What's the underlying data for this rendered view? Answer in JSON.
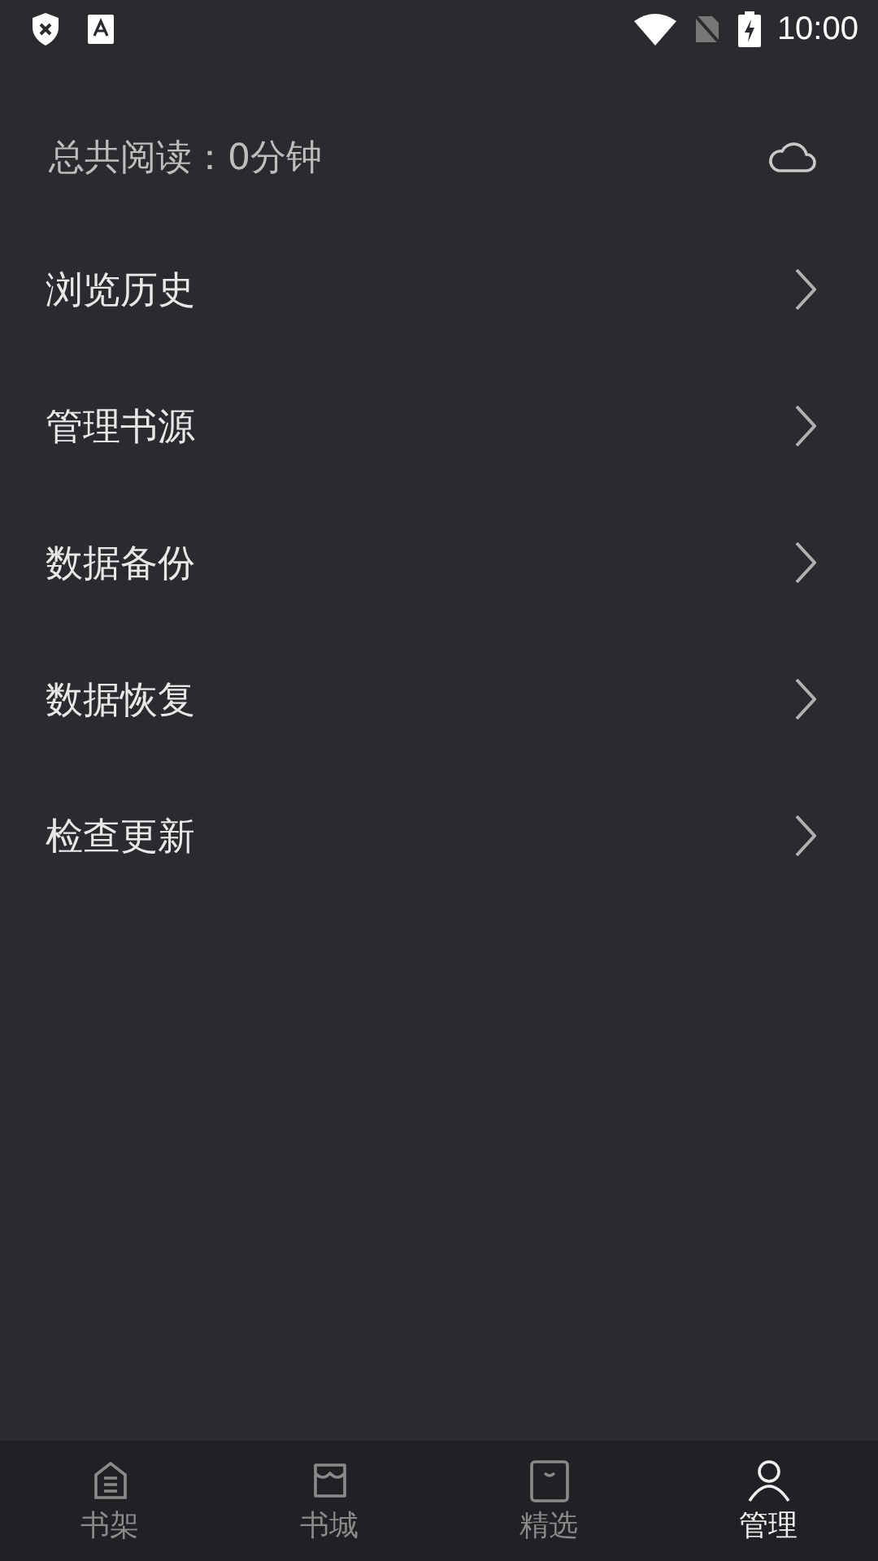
{
  "status_bar": {
    "time": "10:00"
  },
  "header": {
    "total_reading": "总共阅读：0分钟"
  },
  "menu_items": [
    {
      "label": "浏览历史"
    },
    {
      "label": "管理书源"
    },
    {
      "label": "数据备份"
    },
    {
      "label": "数据恢复"
    },
    {
      "label": "检查更新"
    }
  ],
  "bottom_nav": [
    {
      "label": "书架",
      "kind": "shelf",
      "selected": false
    },
    {
      "label": "书城",
      "kind": "store",
      "selected": false
    },
    {
      "label": "精选",
      "kind": "bag",
      "selected": false
    },
    {
      "label": "管理",
      "kind": "user",
      "selected": true
    }
  ]
}
